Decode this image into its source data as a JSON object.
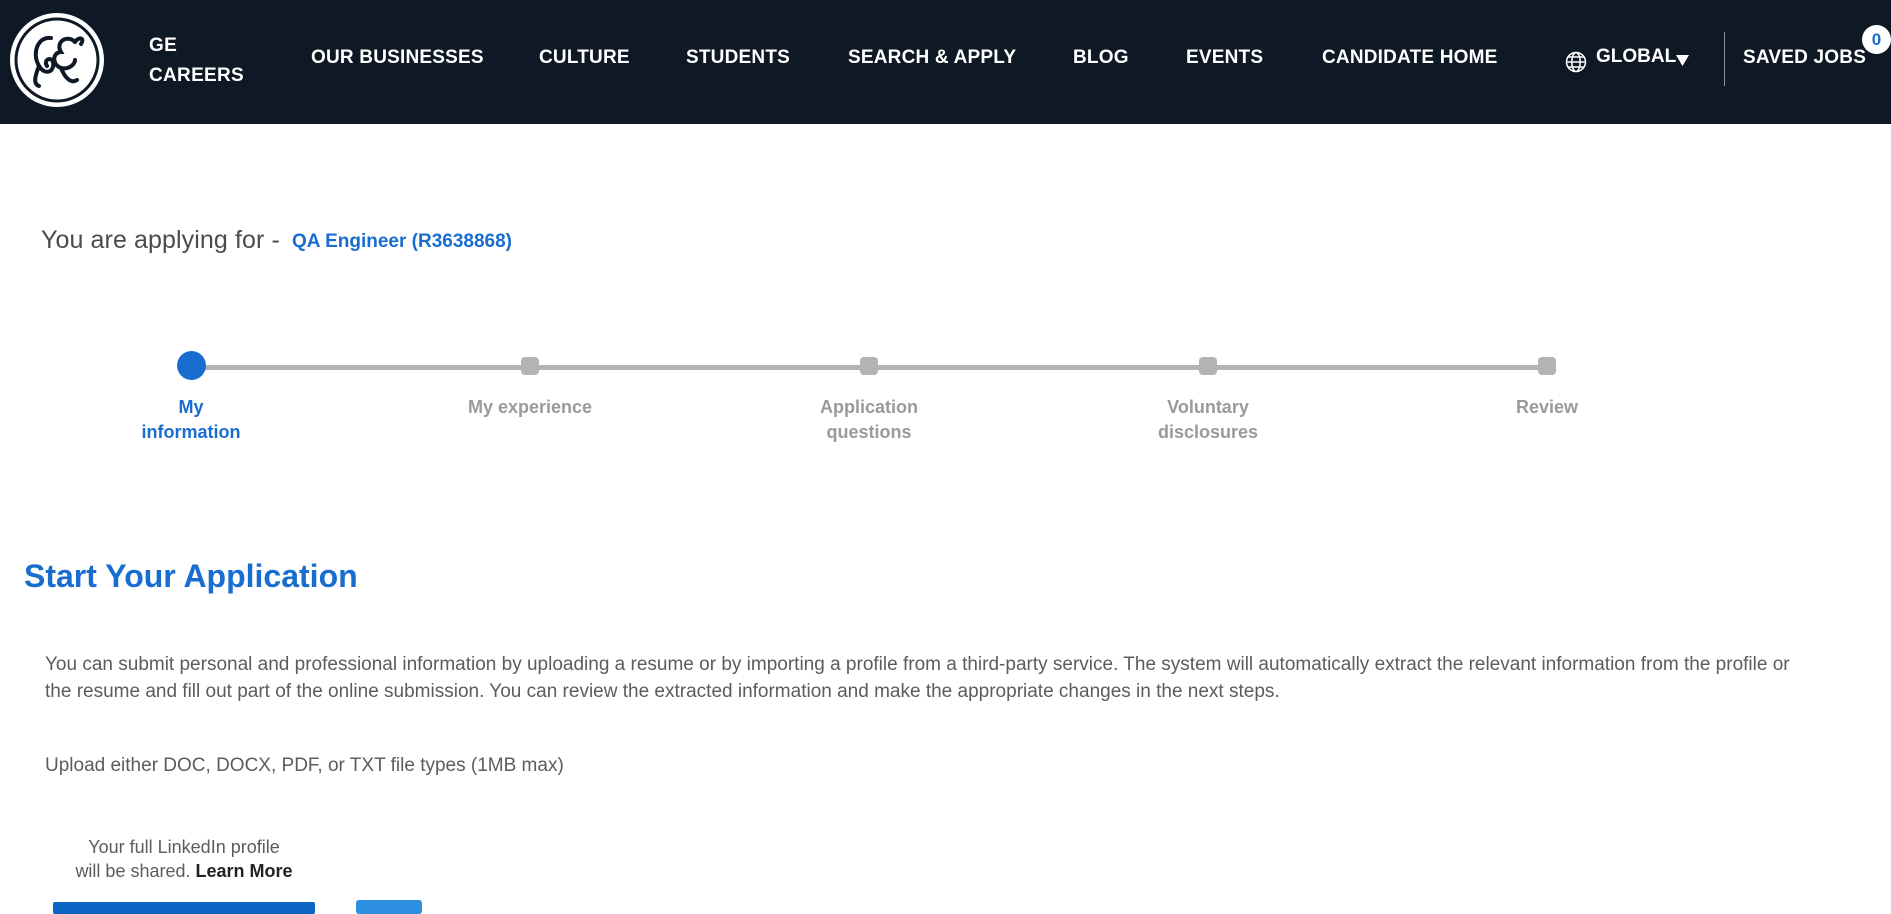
{
  "header": {
    "brand_line1": "GE",
    "brand_line2": "CAREERS",
    "nav": [
      {
        "label": "OUR BUSINESSES"
      },
      {
        "label": "CULTURE"
      },
      {
        "label": "STUDENTS"
      },
      {
        "label": "SEARCH & APPLY"
      },
      {
        "label": "BLOG"
      },
      {
        "label": "EVENTS"
      },
      {
        "label": "CANDIDATE HOME"
      }
    ],
    "region": "GLOBAL",
    "saved_jobs_label": "SAVED JOBS",
    "saved_jobs_count": "0",
    "colors": {
      "background": "#0f1925",
      "text": "#ffffff",
      "badge_text": "#1a6dd0"
    }
  },
  "apply": {
    "prefix": "You are applying for -",
    "job_title": "QA Engineer (R3638868)"
  },
  "steps": [
    {
      "line1": "My",
      "line2": "information",
      "state": "active"
    },
    {
      "line1": "My experience",
      "line2": "",
      "state": "upcoming"
    },
    {
      "line1": "Application",
      "line2": "questions",
      "state": "upcoming"
    },
    {
      "line1": "Voluntary",
      "line2": "disclosures",
      "state": "upcoming"
    },
    {
      "line1": "Review",
      "line2": "",
      "state": "upcoming"
    }
  ],
  "main": {
    "title": "Start Your Application",
    "intro_line1": "You can submit personal and professional information by uploading a resume or by importing a profile from a third-party service. The system will automatically extract the relevant information from the profile or",
    "intro_line2": "the resume and fill out part of the online submission. You can review the extracted information and make the appropriate changes in the next steps.",
    "upload_note": "Upload either DOC, DOCX, PDF, or TXT file types (1MB max)",
    "linkedin_line1": "Your full LinkedIn profile",
    "linkedin_line2": "will be shared.",
    "learn_more": "Learn More"
  },
  "colors": {
    "accent": "#1a6dd0",
    "muted": "#9a9a9a",
    "body_text": "#5c5c5c"
  },
  "icons": {
    "logo": "ge-logo",
    "region": "globe-icon",
    "caret": "caret-down-icon"
  }
}
